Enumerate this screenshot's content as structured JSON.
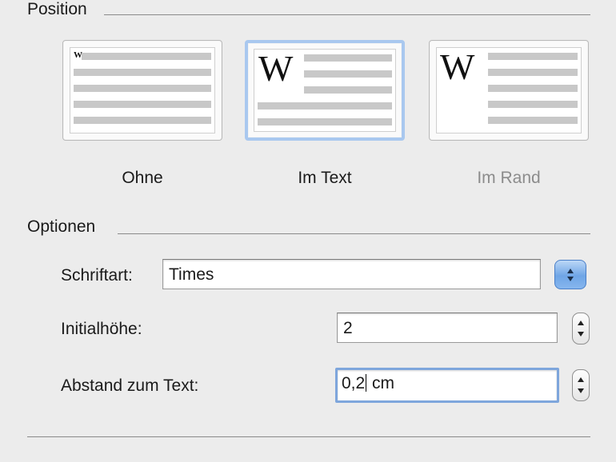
{
  "position": {
    "title": "Position",
    "options": [
      {
        "label": "Ohne",
        "state": "normal"
      },
      {
        "label": "Im Text",
        "state": "selected"
      },
      {
        "label": "Im Rand",
        "state": "disabled"
      }
    ],
    "preview_letter": "W"
  },
  "options_section": {
    "title": "Optionen",
    "font": {
      "label": "Schriftart:",
      "value": "Times"
    },
    "lines": {
      "label": "Initialhöhe:",
      "value": "2"
    },
    "distance": {
      "label": "Abstand zum Text:",
      "value_before_caret": "0,2",
      "value_after_caret": " cm"
    }
  },
  "colors": {
    "selection_border": "#a9c8ef",
    "focus_ring": "#7ea6dc",
    "popup_button": "#6fa5e6",
    "disabled_text": "#8c8c8c"
  }
}
